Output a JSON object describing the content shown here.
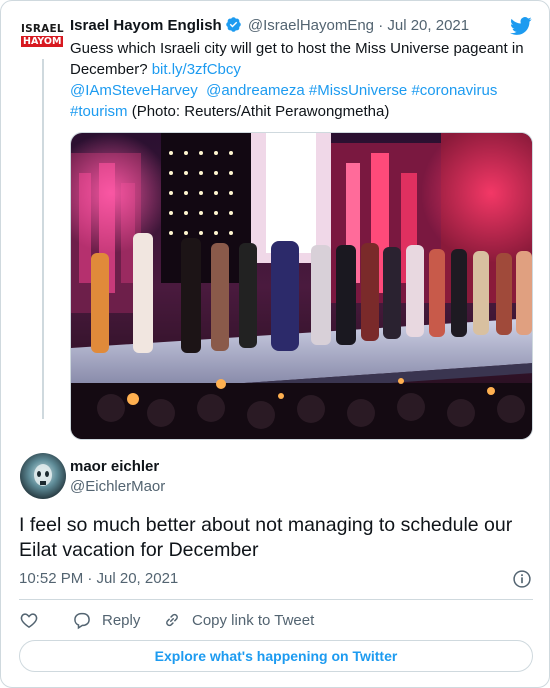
{
  "parent_tweet": {
    "logo_line1": "ISRAEL",
    "logo_line2": "HAYOM",
    "author_name": "Israel Hayom English",
    "handle": "@IsraelHayomEng",
    "dot": "·",
    "date": "Jul 20, 2021",
    "text_line1": "Guess which Israeli city will get to host the Miss Universe pageant in",
    "text_line2_prefix": "December? ",
    "link_url": "bit.ly/3zfCbcy",
    "mention1": "@IAmSteveHarvey",
    "mention2": "@andreameza",
    "hashtag1": "#MissUniverse",
    "hashtag2": "#coronavirus",
    "hashtag3": "#tourism",
    "photo_credit": "(Photo: Reuters/Athit Perawongmetha)"
  },
  "reply_tweet": {
    "author_name": "maor eichler",
    "handle": "@EichlerMaor",
    "text": "I feel so much better about not managing to schedule our Eilat vacation for December",
    "time": "10:52 PM · Jul 20, 2021"
  },
  "actions": {
    "reply_label": "Reply",
    "copy_link_label": "Copy link to Tweet"
  },
  "explore_label": "Explore what's happening on Twitter",
  "colors": {
    "accent": "#1d9bf0",
    "text": "#0f1419",
    "muted": "#536471",
    "border": "#cfd9de",
    "logo_red": "#d71920"
  }
}
